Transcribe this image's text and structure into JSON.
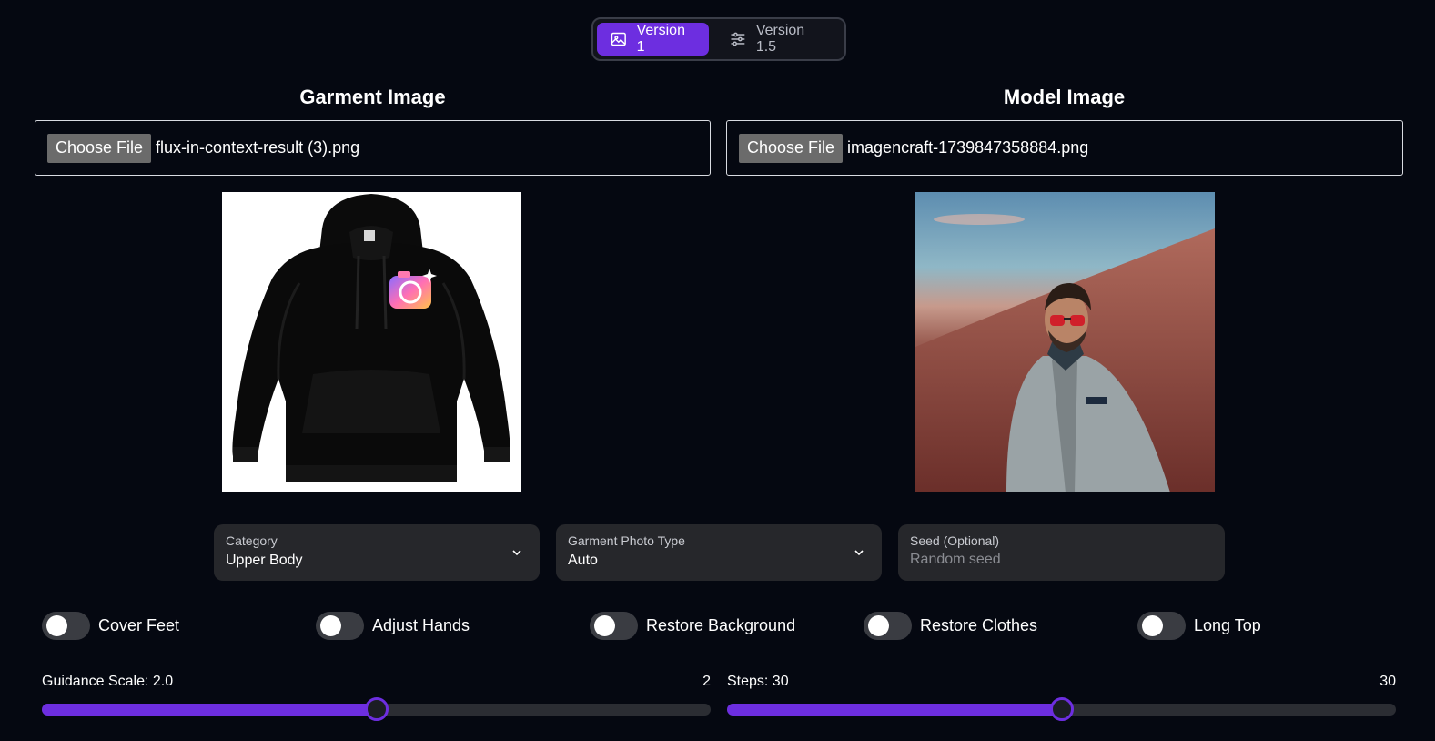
{
  "versions": [
    {
      "label": "Version 1",
      "icon": "image-icon",
      "active": true
    },
    {
      "label": "Version 1.5",
      "icon": "sliders-icon",
      "active": false
    }
  ],
  "garment": {
    "title": "Garment Image",
    "choose_label": "Choose File",
    "file_name": "flux-in-context-result (3).png"
  },
  "model": {
    "title": "Model Image",
    "choose_label": "Choose File",
    "file_name": "imagencraft-1739847358884.png"
  },
  "fields": {
    "category": {
      "label": "Category",
      "value": "Upper Body"
    },
    "photo_type": {
      "label": "Garment Photo Type",
      "value": "Auto"
    },
    "seed": {
      "label": "Seed (Optional)",
      "placeholder": "Random seed"
    }
  },
  "toggles": [
    {
      "label": "Cover Feet",
      "on": false
    },
    {
      "label": "Adjust Hands",
      "on": false
    },
    {
      "label": "Restore Background",
      "on": false
    },
    {
      "label": "Restore Clothes",
      "on": false
    },
    {
      "label": "Long Top",
      "on": false
    }
  ],
  "sliders": {
    "guidance": {
      "label": "Guidance Scale: 2.0",
      "value_text": "2",
      "fraction": 0.5
    },
    "steps": {
      "label": "Steps: 30",
      "value_text": "30",
      "fraction": 0.5
    }
  },
  "colors": {
    "accent": "#6d2ee0",
    "background": "#050811",
    "card": "#26272b"
  }
}
